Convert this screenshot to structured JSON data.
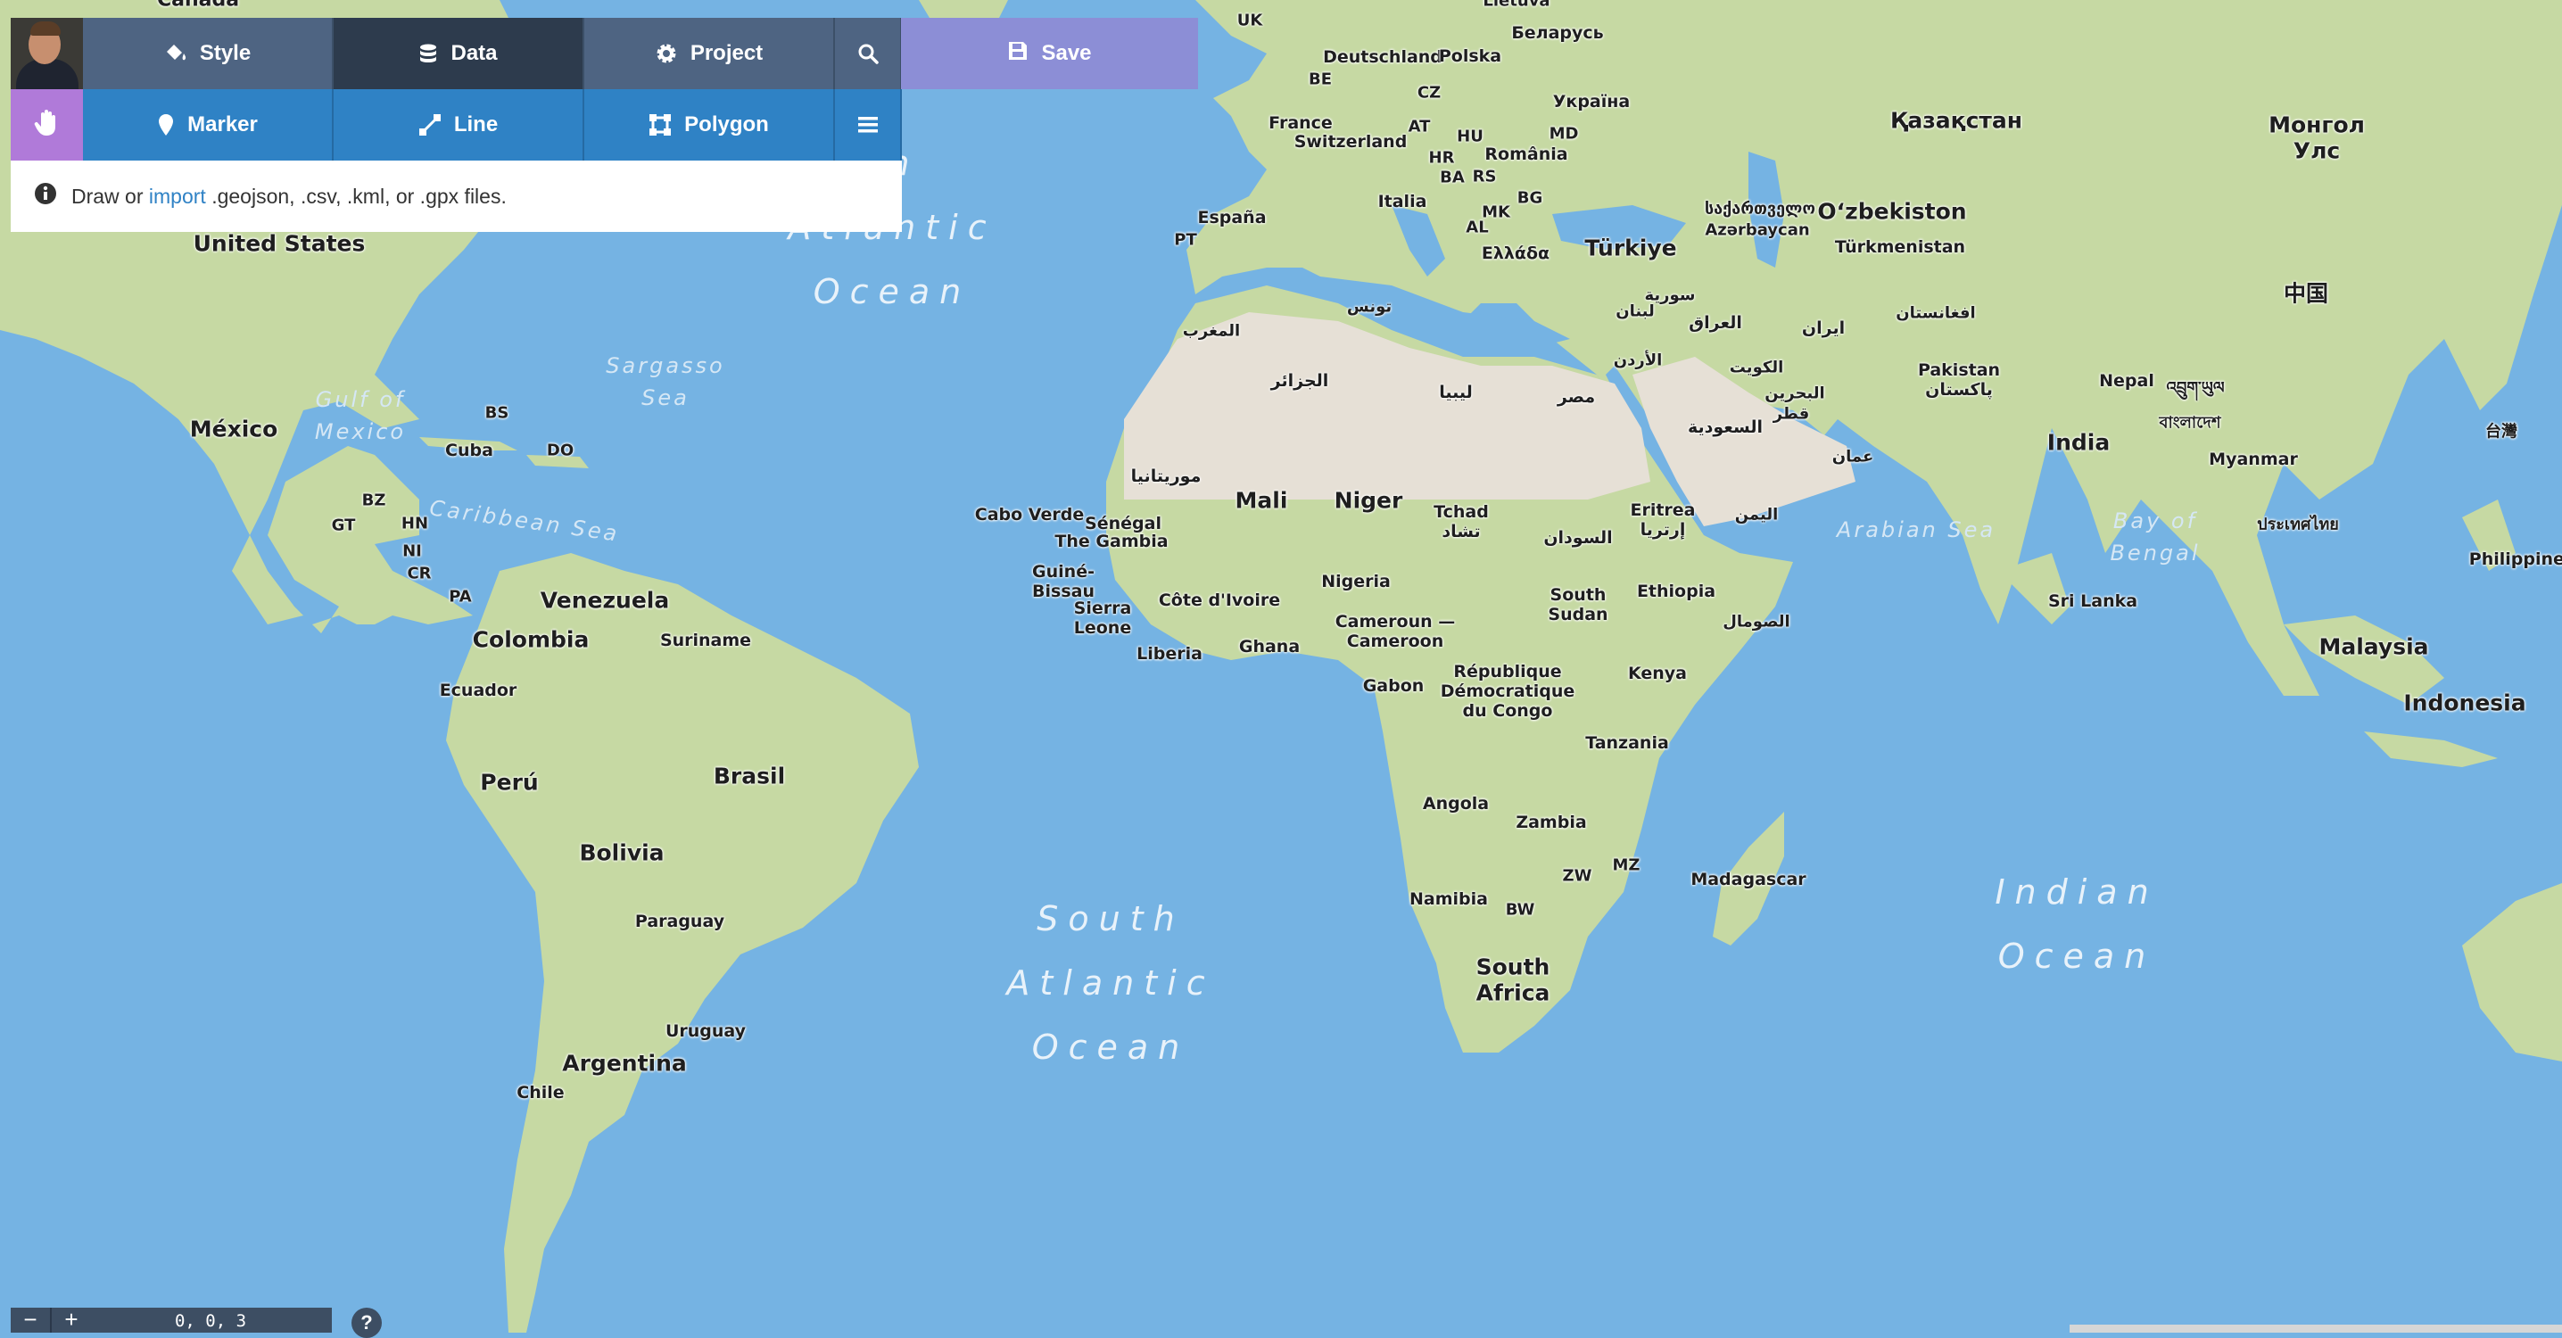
{
  "toolbar": {
    "style_label": "Style",
    "data_label": "Data",
    "project_label": "Project",
    "save_label": "Save",
    "marker_label": "Marker",
    "line_label": "Line",
    "polygon_label": "Polygon"
  },
  "info": {
    "before": "Draw or",
    "link": "import",
    "after": ".geojson, .csv, .kml, or .gpx files."
  },
  "bottom": {
    "zoom_out": "−",
    "zoom_in": "+",
    "coords": "0, 0, 3",
    "help": "?"
  },
  "map": {
    "colors": {
      "ocean": "#75b3e3",
      "land": "#c6d9a3",
      "desert": "#e6e0d6",
      "active_tab": "#2d3b4d",
      "save": "#8c8ed6",
      "draw": "#2f82c5"
    },
    "oceans": [
      {
        "id": "north-atlantic",
        "text": "th\nAtlantic\nOcean"
      },
      {
        "id": "south-atlantic",
        "text": "South\nAtlantic\nOcean"
      },
      {
        "id": "indian",
        "text": "Indian\nOcean"
      }
    ],
    "seas": [
      {
        "id": "sargasso",
        "text": "Sargasso\nSea"
      },
      {
        "id": "gulf-mexico",
        "text": "Gulf of\nMexico"
      },
      {
        "id": "caribbean",
        "text": "Caribbean Sea"
      },
      {
        "id": "arabian",
        "text": "Arabian Sea"
      },
      {
        "id": "bengal",
        "text": "Bay of\nBengal"
      }
    ],
    "countries": [
      {
        "id": "canada",
        "text": "Canada"
      },
      {
        "id": "united-states",
        "text": "United States"
      },
      {
        "id": "mexico",
        "text": "México"
      },
      {
        "id": "bs",
        "text": "BS"
      },
      {
        "id": "cuba",
        "text": "Cuba"
      },
      {
        "id": "do",
        "text": "DO"
      },
      {
        "id": "bz",
        "text": "BZ"
      },
      {
        "id": "gt",
        "text": "GT"
      },
      {
        "id": "hn",
        "text": "HN"
      },
      {
        "id": "ni",
        "text": "NI"
      },
      {
        "id": "cr",
        "text": "CR"
      },
      {
        "id": "pa",
        "text": "PA"
      },
      {
        "id": "venezuela",
        "text": "Venezuela"
      },
      {
        "id": "colombia",
        "text": "Colombia"
      },
      {
        "id": "suriname",
        "text": "Suriname"
      },
      {
        "id": "ecuador",
        "text": "Ecuador"
      },
      {
        "id": "peru",
        "text": "Perú"
      },
      {
        "id": "brasil",
        "text": "Brasil"
      },
      {
        "id": "bolivia",
        "text": "Bolivia"
      },
      {
        "id": "paraguay",
        "text": "Paraguay"
      },
      {
        "id": "uruguay",
        "text": "Uruguay"
      },
      {
        "id": "argentina",
        "text": "Argentina"
      },
      {
        "id": "chile",
        "text": "Chile"
      },
      {
        "id": "uk",
        "text": "UK"
      },
      {
        "id": "lietuva",
        "text": "Lietuva"
      },
      {
        "id": "belarus",
        "text": "Беларусь"
      },
      {
        "id": "deutschland",
        "text": "Deutschland"
      },
      {
        "id": "polska",
        "text": "Polska"
      },
      {
        "id": "be",
        "text": "BE"
      },
      {
        "id": "cz",
        "text": "CZ"
      },
      {
        "id": "ukraina",
        "text": "Україна"
      },
      {
        "id": "france",
        "text": "France"
      },
      {
        "id": "switzerland",
        "text": "Switzerland"
      },
      {
        "id": "at",
        "text": "AT"
      },
      {
        "id": "hu",
        "text": "HU"
      },
      {
        "id": "md",
        "text": "MD"
      },
      {
        "id": "hr",
        "text": "HR"
      },
      {
        "id": "romania",
        "text": "România"
      },
      {
        "id": "ba",
        "text": "BA"
      },
      {
        "id": "rs",
        "text": "RS"
      },
      {
        "id": "italia",
        "text": "Italia"
      },
      {
        "id": "bg",
        "text": "BG"
      },
      {
        "id": "espana",
        "text": "España"
      },
      {
        "id": "pt",
        "text": "PT"
      },
      {
        "id": "mk",
        "text": "MK"
      },
      {
        "id": "al",
        "text": "AL"
      },
      {
        "id": "ellada",
        "text": "Ελλάδα"
      },
      {
        "id": "turkiye",
        "text": "Türkiye"
      },
      {
        "id": "georgia",
        "text": "საქართველო"
      },
      {
        "id": "azerbaycan",
        "text": "Azərbaycan"
      },
      {
        "id": "kazakhstan",
        "text": "Қазақстан"
      },
      {
        "id": "uzbekistan",
        "text": "O‘zbekiston"
      },
      {
        "id": "turkmenistan",
        "text": "Türkmenistan"
      },
      {
        "id": "mongolia",
        "text": "Монгол\nУлс"
      },
      {
        "id": "tunisia",
        "text": "تونس"
      },
      {
        "id": "syria",
        "text": "سورية"
      },
      {
        "id": "lebanon",
        "text": "لبنان"
      },
      {
        "id": "iraq",
        "text": "العراق"
      },
      {
        "id": "iran",
        "text": "ایران"
      },
      {
        "id": "afghanistan",
        "text": "افغانستان"
      },
      {
        "id": "china",
        "text": "中国"
      },
      {
        "id": "morocco",
        "text": "المغرب"
      },
      {
        "id": "jordan",
        "text": "الأردن"
      },
      {
        "id": "kuwait",
        "text": "الكويت"
      },
      {
        "id": "pakistan",
        "text": "Pakistan\nپاکستان"
      },
      {
        "id": "algeria",
        "text": "الجزائر"
      },
      {
        "id": "libya",
        "text": "ليبيا"
      },
      {
        "id": "egypt",
        "text": "مصر"
      },
      {
        "id": "bahrain",
        "text": "البحرين"
      },
      {
        "id": "qatar",
        "text": "قطر"
      },
      {
        "id": "nepal",
        "text": "Nepal"
      },
      {
        "id": "bhutan",
        "text": "འབྲུག་ཡུལ"
      },
      {
        "id": "saudi",
        "text": "السعودية"
      },
      {
        "id": "oman",
        "text": "عمان"
      },
      {
        "id": "bangladesh",
        "text": "বাংলাদেশ"
      },
      {
        "id": "india",
        "text": "India"
      },
      {
        "id": "taiwan",
        "text": "台灣"
      },
      {
        "id": "mauritania",
        "text": "موريتانيا"
      },
      {
        "id": "myanmar",
        "text": "Myanmar"
      },
      {
        "id": "mali",
        "text": "Mali"
      },
      {
        "id": "niger",
        "text": "Niger"
      },
      {
        "id": "tchad",
        "text": "Tchad\nتشاد"
      },
      {
        "id": "eritrea",
        "text": "Eritrea\nإرتريا"
      },
      {
        "id": "yemen",
        "text": "اليمن"
      },
      {
        "id": "cabo-verde",
        "text": "Cabo Verde"
      },
      {
        "id": "senegal",
        "text": "Sénégal"
      },
      {
        "id": "gambia",
        "text": "The Gambia"
      },
      {
        "id": "sudan",
        "text": "السودان"
      },
      {
        "id": "thailand",
        "text": "ประเทศไทย"
      },
      {
        "id": "guine-bissau",
        "text": "Guiné-\nBissau"
      },
      {
        "id": "philippines",
        "text": "Philippines"
      },
      {
        "id": "nigeria",
        "text": "Nigeria"
      },
      {
        "id": "south-sudan",
        "text": "South\nSudan"
      },
      {
        "id": "ethiopia",
        "text": "Ethiopia"
      },
      {
        "id": "cote-divoire",
        "text": "Côte d'Ivoire"
      },
      {
        "id": "sri-lanka",
        "text": "Sri Lanka"
      },
      {
        "id": "sierra-leone",
        "text": "Sierra\nLeone"
      },
      {
        "id": "somalia",
        "text": "الصومال"
      },
      {
        "id": "cameroun",
        "text": "Cameroun —\nCameroon"
      },
      {
        "id": "ghana",
        "text": "Ghana"
      },
      {
        "id": "malaysia",
        "text": "Malaysia"
      },
      {
        "id": "liberia",
        "text": "Liberia"
      },
      {
        "id": "rdc",
        "text": "République\nDémocratique\ndu Congo"
      },
      {
        "id": "kenya",
        "text": "Kenya"
      },
      {
        "id": "gabon",
        "text": "Gabon"
      },
      {
        "id": "indonesia",
        "text": "Indonesia"
      },
      {
        "id": "tanzania",
        "text": "Tanzania"
      },
      {
        "id": "angola",
        "text": "Angola"
      },
      {
        "id": "zambia",
        "text": "Zambia"
      },
      {
        "id": "mz",
        "text": "MZ"
      },
      {
        "id": "zw",
        "text": "ZW"
      },
      {
        "id": "madagascar",
        "text": "Madagascar"
      },
      {
        "id": "namibia",
        "text": "Namibia"
      },
      {
        "id": "bw",
        "text": "BW"
      },
      {
        "id": "south-africa",
        "text": "South\nAfrica"
      }
    ]
  }
}
